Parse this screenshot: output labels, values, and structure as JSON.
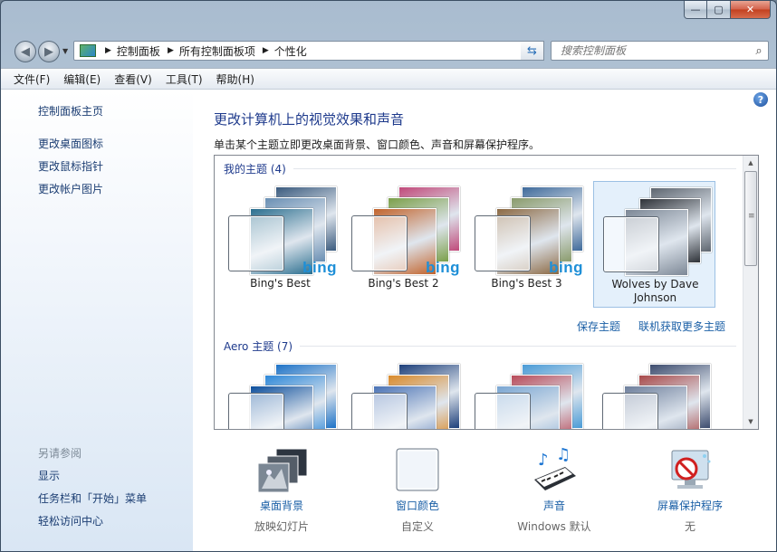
{
  "window": {
    "minimize": "—",
    "maximize": "▢",
    "close": "✕"
  },
  "nav": {
    "address_crumbs": [
      "控制面板",
      "所有控制面板项",
      "个性化"
    ],
    "search_placeholder": "搜索控制面板"
  },
  "menu": [
    "文件(F)",
    "编辑(E)",
    "查看(V)",
    "工具(T)",
    "帮助(H)"
  ],
  "sidebar": {
    "home": "控制面板主页",
    "links": [
      "更改桌面图标",
      "更改鼠标指针",
      "更改帐户图片"
    ],
    "see_also": "另请参阅",
    "see_also_links": [
      "显示",
      "任务栏和「开始」菜单",
      "轻松访问中心"
    ]
  },
  "main": {
    "title": "更改计算机上的视觉效果和声音",
    "description": "单击某个主题立即更改桌面背景、窗口颜色、声音和屏幕保护程序。"
  },
  "gallery": {
    "my_themes_heading": "我的主题 (4)",
    "my_themes": [
      {
        "name": "Bing's Best",
        "brand": "bing",
        "colors": [
          "#3b5b7e",
          "#6a8fb3",
          "#2b6f8f"
        ]
      },
      {
        "name": "Bing's Best 2",
        "brand": "bing",
        "colors": [
          "#c04a7a",
          "#7b9f4a",
          "#c2642c"
        ]
      },
      {
        "name": "Bing's Best 3",
        "brand": "bing",
        "colors": [
          "#3f6a9a",
          "#8a9b6c",
          "#8c6a44"
        ]
      },
      {
        "name": "Wolves by Dave Johnson",
        "brand": "",
        "colors": [
          "#5e6670",
          "#2e3238",
          "#7d8896"
        ]
      }
    ],
    "save_theme": "保存主题",
    "get_more": "联机获取更多主题",
    "aero_heading": "Aero 主题 (7)",
    "aero_colors": [
      [
        "#1e73c7",
        "#2e88d8",
        "#0d4f9c"
      ],
      [
        "#1d3f7a",
        "#d98a2b",
        "#4b73b5"
      ],
      [
        "#4a9bd6",
        "#b84b59",
        "#7aa6d2"
      ],
      [
        "#3d4c6e",
        "#a84a4a",
        "#6e7f9c"
      ]
    ],
    "selected_index": 3
  },
  "bottom": [
    {
      "label": "桌面背景",
      "sub": "放映幻灯片",
      "icon": "desktop-background-icon"
    },
    {
      "label": "窗口颜色",
      "sub": "自定义",
      "icon": "window-color-icon"
    },
    {
      "label": "声音",
      "sub": "Windows 默认",
      "icon": "sound-icon"
    },
    {
      "label": "屏幕保护程序",
      "sub": "无",
      "icon": "screen-saver-icon"
    }
  ]
}
